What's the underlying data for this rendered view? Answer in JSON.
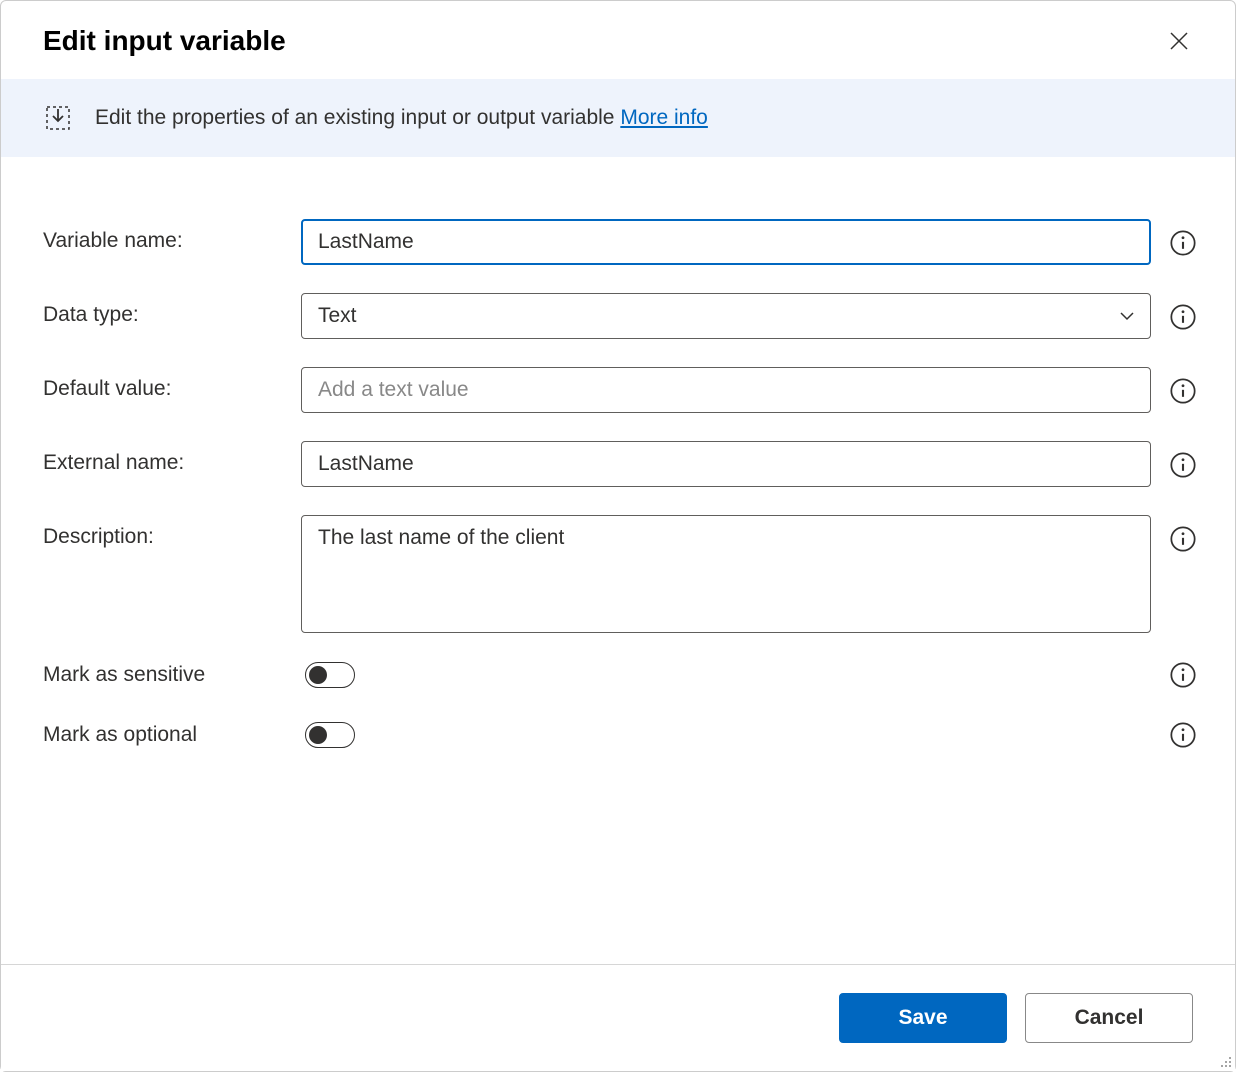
{
  "dialog": {
    "title": "Edit input variable",
    "banner_text": "Edit the properties of an existing input or output variable ",
    "more_info_label": "More info"
  },
  "form": {
    "variable_name": {
      "label": "Variable name:",
      "value": "LastName"
    },
    "data_type": {
      "label": "Data type:",
      "value": "Text"
    },
    "default_value": {
      "label": "Default value:",
      "value": "",
      "placeholder": "Add a text value"
    },
    "external_name": {
      "label": "External name:",
      "value": "LastName"
    },
    "description": {
      "label": "Description:",
      "value": "The last name of the client"
    },
    "mark_sensitive": {
      "label": "Mark as sensitive",
      "value": false
    },
    "mark_optional": {
      "label": "Mark as optional",
      "value": false
    }
  },
  "buttons": {
    "save": "Save",
    "cancel": "Cancel"
  }
}
